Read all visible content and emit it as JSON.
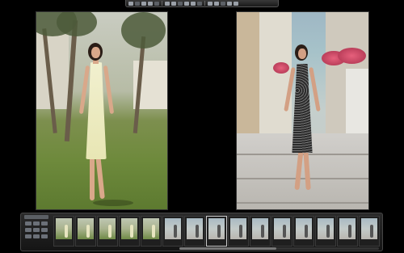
{
  "toolbar": {
    "buttons": [
      {
        "name": "import-icon",
        "state": "normal"
      },
      {
        "name": "grid-view-icon",
        "state": "normal"
      },
      {
        "name": "compare-view-icon",
        "state": "active"
      },
      {
        "name": "single-view-icon",
        "state": "normal"
      },
      {
        "name": "filmstrip-icon",
        "state": "normal"
      },
      {
        "name": "rotate-left-icon",
        "state": "normal"
      },
      {
        "name": "rotate-right-icon",
        "state": "normal"
      },
      {
        "name": "flag-icon",
        "state": "normal"
      },
      {
        "name": "star-icon",
        "state": "normal"
      },
      {
        "name": "crop-icon",
        "state": "normal"
      },
      {
        "name": "adjust-icon",
        "state": "normal"
      },
      {
        "name": "loupe-icon",
        "state": "normal"
      },
      {
        "name": "zoom-icon",
        "state": "normal"
      },
      {
        "name": "info-icon",
        "state": "normal"
      },
      {
        "name": "export-icon",
        "state": "normal"
      },
      {
        "name": "settings-icon",
        "state": "normal"
      }
    ]
  },
  "viewers": {
    "left": {
      "description_icon": "photo-woman-yellow-dress"
    },
    "right": {
      "description_icon": "photo-woman-black-dress"
    }
  },
  "filmstrip": {
    "title": "",
    "thumbnails": [
      {
        "caption": "",
        "variant": "green",
        "selected": false
      },
      {
        "caption": "",
        "variant": "green",
        "selected": false
      },
      {
        "caption": "",
        "variant": "green",
        "selected": false
      },
      {
        "caption": "",
        "variant": "green",
        "selected": false
      },
      {
        "caption": "",
        "variant": "green",
        "selected": false
      },
      {
        "caption": "",
        "variant": "street",
        "selected": false
      },
      {
        "caption": "",
        "variant": "street",
        "selected": false
      },
      {
        "caption": "",
        "variant": "street",
        "selected": true
      },
      {
        "caption": "",
        "variant": "street",
        "selected": false
      },
      {
        "caption": "",
        "variant": "street",
        "selected": false
      },
      {
        "caption": "",
        "variant": "street",
        "selected": false
      },
      {
        "caption": "",
        "variant": "street",
        "selected": false
      },
      {
        "caption": "",
        "variant": "street",
        "selected": false
      },
      {
        "caption": "",
        "variant": "street",
        "selected": false
      },
      {
        "caption": "",
        "variant": "street",
        "selected": false
      }
    ]
  }
}
